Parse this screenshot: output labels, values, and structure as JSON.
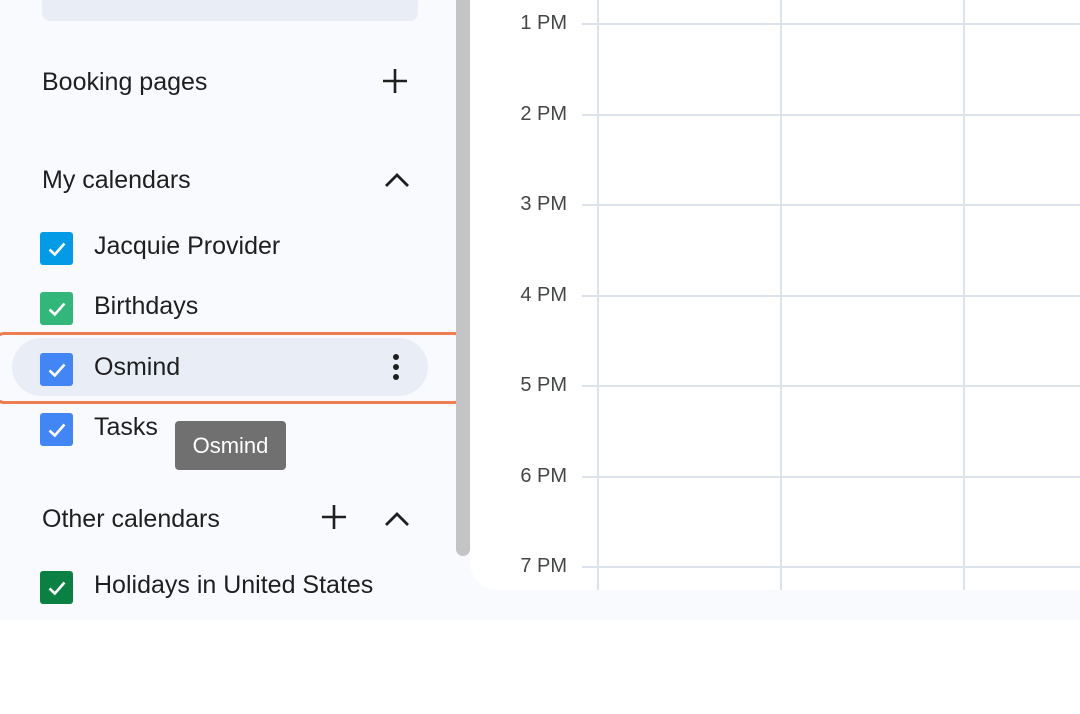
{
  "sidebar": {
    "booking": {
      "title": "Booking pages"
    },
    "my_calendars": {
      "title": "My calendars",
      "items": [
        {
          "label": "Jacquie Provider",
          "color": "#039be5"
        },
        {
          "label": "Birthdays",
          "color": "#33b679"
        },
        {
          "label": "Osmind",
          "color": "#4285f4"
        },
        {
          "label": "Tasks",
          "color": "#4285f4"
        }
      ]
    },
    "other_calendars": {
      "title": "Other calendars",
      "items": [
        {
          "label": "Holidays in United States",
          "color": "#0b8043"
        }
      ]
    },
    "tooltip": "Osmind"
  },
  "grid": {
    "hours": [
      "1 PM",
      "2 PM",
      "3 PM",
      "4 PM",
      "5 PM",
      "6 PM",
      "7 PM"
    ]
  },
  "colors": {
    "focus_outline": "#ee7d4f",
    "hover_bg": "#e9eef6",
    "gridline": "#dde3ea"
  },
  "icons": {
    "add": "plus-icon",
    "collapse": "chevron-up-icon",
    "more": "more-vert-icon",
    "check": "check-icon"
  }
}
